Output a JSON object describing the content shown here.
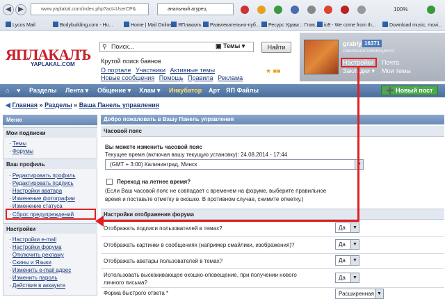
{
  "browser": {
    "url": "www.yaplakal.com/index.php?act=UserCP&",
    "search_query": "анальный агурец",
    "zoom": "100%",
    "bookmarks": [
      "Lycos Mail",
      "Bodybuilding.com - Hu...",
      "Home | Mail Online",
      "ЯПлакалъ",
      "Развлекательно-пуб...",
      "Ресурс Удава :: Глав...",
      "io9 - We come from th...",
      "Download music, movi..."
    ]
  },
  "site": {
    "logo": "ЯПЛАКАЛЪ",
    "logo_sub": "YAPLAKAL.COM",
    "search_placeholder": "Поиск...",
    "search_scope": "Темы",
    "search_button": "Найти",
    "tagline": "Крутой поиск баянов",
    "header_links_row1": [
      "О портале",
      "Участники",
      "Активные темы"
    ],
    "header_links_row2": [
      "Новые сообщения",
      "Помощь",
      "Правила",
      "Реклама"
    ]
  },
  "user": {
    "name": "grably",
    "count": "16371",
    "status": "самовыкатывающиеся",
    "settings": "Настройки",
    "mail": "Почта",
    "bookmarks": "Закладки",
    "my_topics": "Мои темы"
  },
  "nav": {
    "items": [
      "Разделы",
      "Лента",
      "Общение",
      "Хлам",
      "Инкубатор",
      "Арт",
      "ЯП Файлы"
    ],
    "new_post": "Новый пост"
  },
  "breadcrumb": {
    "home": "Главная",
    "sections": "Разделы",
    "current": "Ваша Панель управления"
  },
  "sidebar": {
    "menu_title": "Меню",
    "subscriptions_title": "Мои подписки",
    "subscriptions": [
      "Темы",
      "Форумы"
    ],
    "profile_title": "Ваш профиль",
    "profile": [
      "Редактировать профиль",
      "Редактировать подпись",
      "Настройки аватара",
      "Изменение фотографии",
      "Изменение статуса",
      "Сброс предупреждений"
    ],
    "settings_title": "Настройки",
    "settings": [
      "Настройки e-mail",
      "Настройки форума",
      "Отключить рекламу",
      "Скины и Языки",
      "Изменить e-mail адрес",
      "Изменить пароль",
      "Действия в аккаунте"
    ]
  },
  "main": {
    "welcome": "Добро пожаловать в Вашу Панель управления",
    "tz_section": "Часовой пояс",
    "tz_label": "Вы можете изменить часовой пояс",
    "tz_current": "Текущее время (включая вашу текущую установку): 24.08.2014 - 17:44",
    "tz_value": "(GMT + 3:00) Калининград, Минск",
    "dst_label": "Переход на летнее время?",
    "dst_note_1": "(Если Ваш часовой пояс не совпадает с временем на форуме, выберите правильное",
    "dst_note_2": "время и поставьте отметку в окошко. В противном случае, снимите отметку.)",
    "forum_section": "Настройки отображения форума",
    "options": [
      {
        "label": "Отображать подписи пользователей в темах?",
        "value": "Да"
      },
      {
        "label": "Отображать картинки в сообщениях (например смайлики, изображения)?",
        "value": "Да"
      },
      {
        "label": "Отображать аватары пользователей в темах?",
        "value": "Да"
      },
      {
        "label": "Использовать выскакивающее окошко-оповещение, при получении нового",
        "label2": "личного письма?",
        "value": "Да"
      },
      {
        "label": "Форма быстрого ответа *",
        "value": "Расширенная"
      }
    ]
  }
}
